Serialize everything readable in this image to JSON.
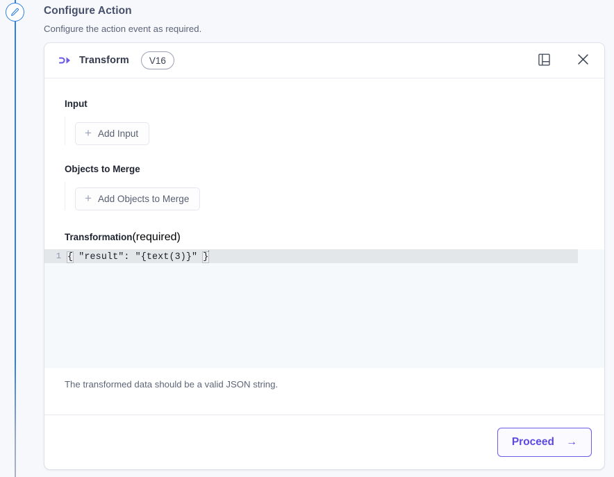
{
  "page": {
    "title": "Configure Action",
    "subtitle": "Configure the action event as required.",
    "step_icon": "pencil-icon"
  },
  "card": {
    "header": {
      "icon": "transform-icon",
      "title": "Transform",
      "version": "V16",
      "notes_icon": "notebook-panel-icon",
      "close_icon": "close-icon"
    },
    "fields": {
      "input": {
        "label": "Input",
        "add_label": "Add Input",
        "add_icon": "plus-icon"
      },
      "objects_to_merge": {
        "label": "Objects to Merge",
        "add_label": "Add Objects to Merge",
        "add_icon": "plus-icon"
      },
      "transformation": {
        "label": "Transformation",
        "required_note": "(required)",
        "line_number": "1",
        "code_open_brace": "{",
        "code_middle": " \"result\": \"{text(3)}\" ",
        "code_close_brace": "}",
        "helper_text": "The transformed data should be a valid JSON string."
      }
    },
    "footer": {
      "proceed_label": "Proceed",
      "proceed_arrow": "→"
    }
  },
  "colors": {
    "accent_purple": "#6c5ce7",
    "rail_blue": "#2f7fe0",
    "page_background": "#f7f8fb",
    "editor_background": "#f5f9fc",
    "active_line": "#e3e7ea"
  }
}
